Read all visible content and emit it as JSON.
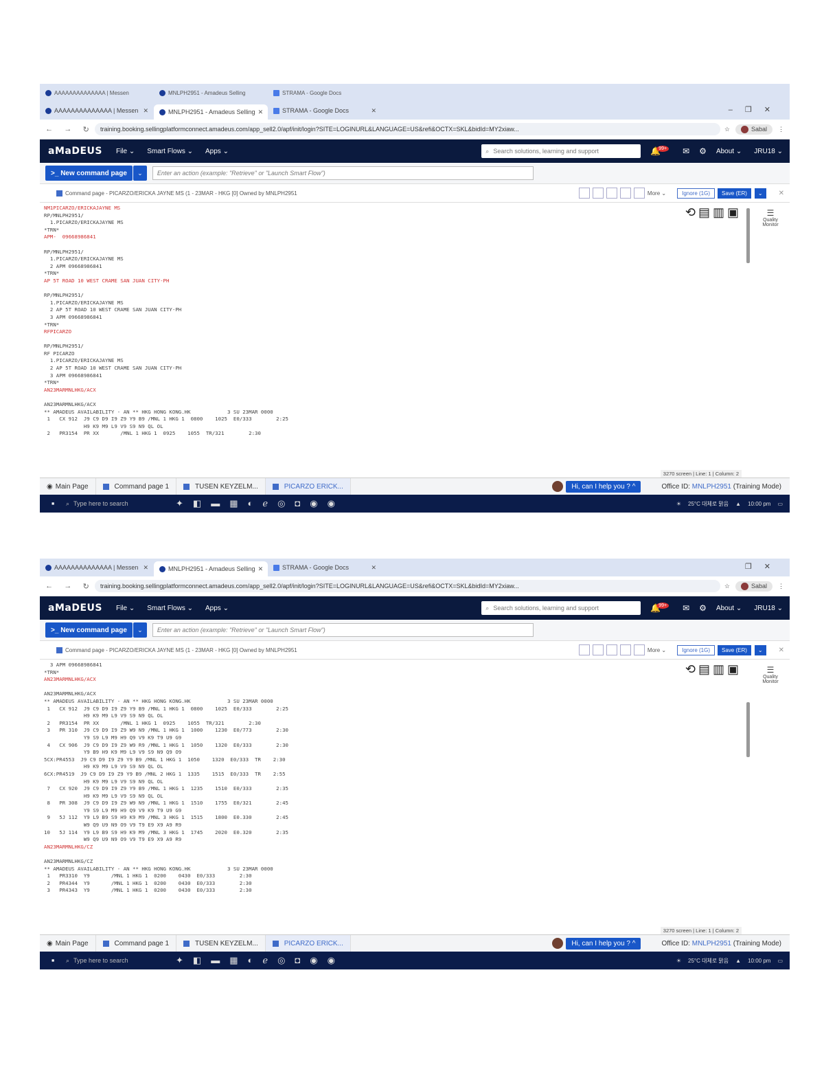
{
  "shot1": {
    "prev_tabs": [
      "AAAAAAAAAAAAAA | Messen",
      "MNLPH2951 - Amadeus Selling",
      "STRAMA - Google Docs"
    ],
    "tabs": [
      {
        "label": "AAAAAAAAAAAAAA | Messen",
        "icon": "messenger-icon"
      },
      {
        "label": "MNLPH2951 - Amadeus Selling",
        "icon": "amadeus-icon"
      },
      {
        "label": "STRAMA - Google Docs",
        "icon": "docs-icon"
      }
    ],
    "url": "training.booking.sellingplatformconnect.amadeus.com/app_sell2.0/apf/init/login?SITE=LOGINURL&LANGUAGE=US&refi&OCTX=SKL&bidId=MY2xiaw...",
    "profile": "Sabal",
    "menu": [
      "File",
      "Smart Flows",
      "Apps"
    ],
    "search_placeholder": "Search solutions, learning and support",
    "notif_count": "99+",
    "about": "About",
    "user": "JRU18",
    "new_command": "New command page",
    "action_placeholder": "Enter an action (example: \"Retrieve\" or \"Launch Smart Flow\")",
    "page_title": "Command page - PICARZO/ERICKA JAYNE MS (1 - 23MAR - HKG [0] Owned by MNLPH2951",
    "more": "More",
    "ignore": "Ignore (1G)",
    "save": "Save (ER)",
    "terminal": [
      {
        "t": "NM1PICARZO/ERICKAJAYNE MS",
        "red": true
      },
      {
        "t": "RP/MNLPH2951/"
      },
      {
        "t": "  1.PICARZO/ERICKAJAYNE MS"
      },
      {
        "t": "*TRN*"
      },
      {
        "t": "APM-  09668986841",
        "red": true
      },
      {
        "t": ""
      },
      {
        "t": "RP/MNLPH2951/"
      },
      {
        "t": "  1.PICARZO/ERICKAJAYNE MS"
      },
      {
        "t": "  2 APM 09668986841"
      },
      {
        "t": "*TRN*"
      },
      {
        "t": "AP 5T ROAD 10 WEST CRAME SAN JUAN CITY-PH",
        "red": true
      },
      {
        "t": ""
      },
      {
        "t": "RP/MNLPH2951/"
      },
      {
        "t": "  1.PICARZO/ERICKAJAYNE MS"
      },
      {
        "t": "  2 AP 5T ROAD 10 WEST CRAME SAN JUAN CITY-PH"
      },
      {
        "t": "  3 APM 09668986841"
      },
      {
        "t": "*TRN*"
      },
      {
        "t": "RFPICARZO",
        "red": true
      },
      {
        "t": ""
      },
      {
        "t": "RP/MNLPH2951/"
      },
      {
        "t": "RF PICARZO"
      },
      {
        "t": "  1.PICARZO/ERICKAJAYNE MS"
      },
      {
        "t": "  2 AP 5T ROAD 10 WEST CRAME SAN JUAN CITY-PH"
      },
      {
        "t": "  3 APM 09668986841"
      },
      {
        "t": "*TRN*"
      },
      {
        "t": "AN23MARMNLHKG/ACX",
        "red": true
      },
      {
        "t": ""
      },
      {
        "t": "AN23MARMNLHKG/ACX"
      },
      {
        "t": "** AMADEUS AVAILABILITY - AN ** HKG HONG KONG.HK            3 SU 23MAR 0000"
      },
      {
        "t": " 1   CX 912  J9 C9 D9 I9 Z9 Y9 B9 /MNL 1 HKG 1  0800    1025  E0/333        2:25"
      },
      {
        "t": "             H9 K9 M9 L9 V9 S9 N9 QL OL"
      },
      {
        "t": " 2   PR3154  PR XX       /MNL 1 HKG 1  0925    1055  TR/321        2:30"
      }
    ],
    "layout_icons": [
      "history-icon",
      "split-h-icon",
      "split-v-icon",
      "screen-icon"
    ],
    "quality_monitor": "Quality Monitor",
    "status": "3270 screen | Line: 1 | Column: 2",
    "bottom_tabs": [
      "Main Page",
      "Command page 1",
      "TUSEN KEYZELM...",
      "PICARZO ERICK..."
    ],
    "help": "Hi, can I help you ?",
    "office_label": "Office ID:",
    "office_id": "MNLPH2951",
    "office_mode": "(Training Mode)",
    "taskbar_search": "Type here to search",
    "weather": "25°C 대체로 맑음",
    "clock": "10:00 pm"
  },
  "shot2": {
    "tabs": [
      {
        "label": "AAAAAAAAAAAAAA | Messen",
        "icon": "messenger-icon"
      },
      {
        "label": "MNLPH2951 - Amadeus Selling",
        "icon": "amadeus-icon"
      },
      {
        "label": "STRAMA - Google Docs",
        "icon": "docs-icon"
      }
    ],
    "url": "training.booking.sellingplatformconnect.amadeus.com/app_sell2.0/apf/init/login?SITE=LOGINURL&LANGUAGE=US&refi&OCTX=SKL&bidId=MY2xiaw...",
    "profile": "Sabal",
    "menu": [
      "File",
      "Smart Flows",
      "Apps"
    ],
    "search_placeholder": "Search solutions, learning and support",
    "notif_count": "99+",
    "about": "About",
    "user": "JRU18",
    "new_command": "New command page",
    "action_placeholder": "Enter an action (example: \"Retrieve\" or \"Launch Smart Flow\")",
    "page_title": "Command page - PICARZO/ERICKA JAYNE MS (1 - 23MAR - HKG [0] Owned by MNLPH2951",
    "more": "More",
    "ignore": "Ignore (1G)",
    "save": "Save (ER)",
    "terminal": [
      {
        "t": "  3 APM 09668986841"
      },
      {
        "t": "*TRN*"
      },
      {
        "t": "AN23MARMNLHKG/ACX",
        "red": true
      },
      {
        "t": ""
      },
      {
        "t": "AN23MARMNLHKG/ACX"
      },
      {
        "t": "** AMADEUS AVAILABILITY - AN ** HKG HONG KONG.HK            3 SU 23MAR 0000"
      },
      {
        "t": " 1   CX 912  J9 C9 D9 I9 Z9 Y9 B9 /MNL 1 HKG 1  0800    1025  E0/333        2:25"
      },
      {
        "t": "             H9 K9 M9 L9 V9 S9 N9 QL OL"
      },
      {
        "t": " 2   PR3154  PR XX       /MNL 1 HKG 1  0925    1055  TR/321        2:30"
      },
      {
        "t": " 3   PR 310  J9 C9 D9 I9 Z9 W9 N9 /MNL 1 HKG 1  1000    1230  E0/773        2:30"
      },
      {
        "t": "             Y9 S9 L9 M9 H9 Q9 V9 K9 T9 U9 G9"
      },
      {
        "t": " 4   CX 906  J9 C9 D9 I9 Z9 W9 R9 /MNL 1 HKG 1  1050    1320  E0/333        2:30"
      },
      {
        "t": "             Y9 B9 H9 K9 M9 L9 V9 S9 N9 Q9 O9"
      },
      {
        "t": "5CX:PR4553  J9 C9 D9 I9 Z9 Y9 B9 /MNL 1 HKG 1  1050    1320  E0/333  TR    2:30"
      },
      {
        "t": "             H9 K9 M9 L9 V9 S9 N9 QL OL"
      },
      {
        "t": "6CX:PR4519  J9 C9 D9 I9 Z9 Y9 B9 /MNL 2 HKG 1  1335    1515  E0/333  TR    2:55"
      },
      {
        "t": "             H9 K9 M9 L9 V9 S9 N9 QL OL"
      },
      {
        "t": " 7   CX 920  J9 C9 D9 I9 Z9 Y9 B9 /MNL 1 HKG 1  1235    1510  E0/333        2:35"
      },
      {
        "t": "             H9 K9 M9 L9 V9 S9 N9 QL OL"
      },
      {
        "t": " 8   PR 308  J9 C9 D9 I9 Z9 W9 N9 /MNL 1 HKG 1  1510    1755  E0/321        2:45"
      },
      {
        "t": "             Y9 S9 L9 M9 H9 Q9 V9 K9 T9 U9 G9"
      },
      {
        "t": " 9   5J 112  Y9 L9 B9 S9 H9 K9 M9 /MNL 3 HKG 1  1515    1800  E0.330        2:45"
      },
      {
        "t": "             W9 Q9 U9 N9 O9 V9 T9 E9 X9 A9 R9"
      },
      {
        "t": "10   5J 114  Y9 L9 B9 S9 H9 K9 M9 /MNL 3 HKG 1  1745    2020  E0.320        2:35"
      },
      {
        "t": "             W9 Q9 U9 N9 O9 V9 T9 E9 X9 A9 R9"
      },
      {
        "t": "AN23MARMNLHKG/CZ",
        "red": true
      },
      {
        "t": ""
      },
      {
        "t": "AN23MARMNLHKG/CZ"
      },
      {
        "t": "** AMADEUS AVAILABILITY - AN ** HKG HONG KONG.HK            3 SU 23MAR 0000"
      },
      {
        "t": " 1   PR3310  Y9       /MNL 1 HKG 1  0200    0430  E0/333        2:30"
      },
      {
        "t": " 2   PR4344  Y9       /MNL 1 HKG 1  0200    0430  E0/333        2:30"
      },
      {
        "t": " 3   PR4343  Y9       /MNL 1 HKG 1  0200    0430  E0/333        2:30"
      }
    ],
    "layout_icons": [
      "history-icon",
      "split-h-icon",
      "split-v-icon",
      "screen-icon"
    ],
    "quality_monitor": "Quality Monitor",
    "status": "3270 screen | Line: 1 | Column: 2",
    "bottom_tabs": [
      "Main Page",
      "Command page 1",
      "TUSEN KEYZELM...",
      "PICARZO ERICK..."
    ],
    "help": "Hi, can I help you ?",
    "office_label": "Office ID:",
    "office_id": "MNLPH2951",
    "office_mode": "(Training Mode)",
    "taskbar_search": "Type here to search",
    "weather": "25°C 대체로 맑음",
    "clock": "10:00 pm"
  }
}
